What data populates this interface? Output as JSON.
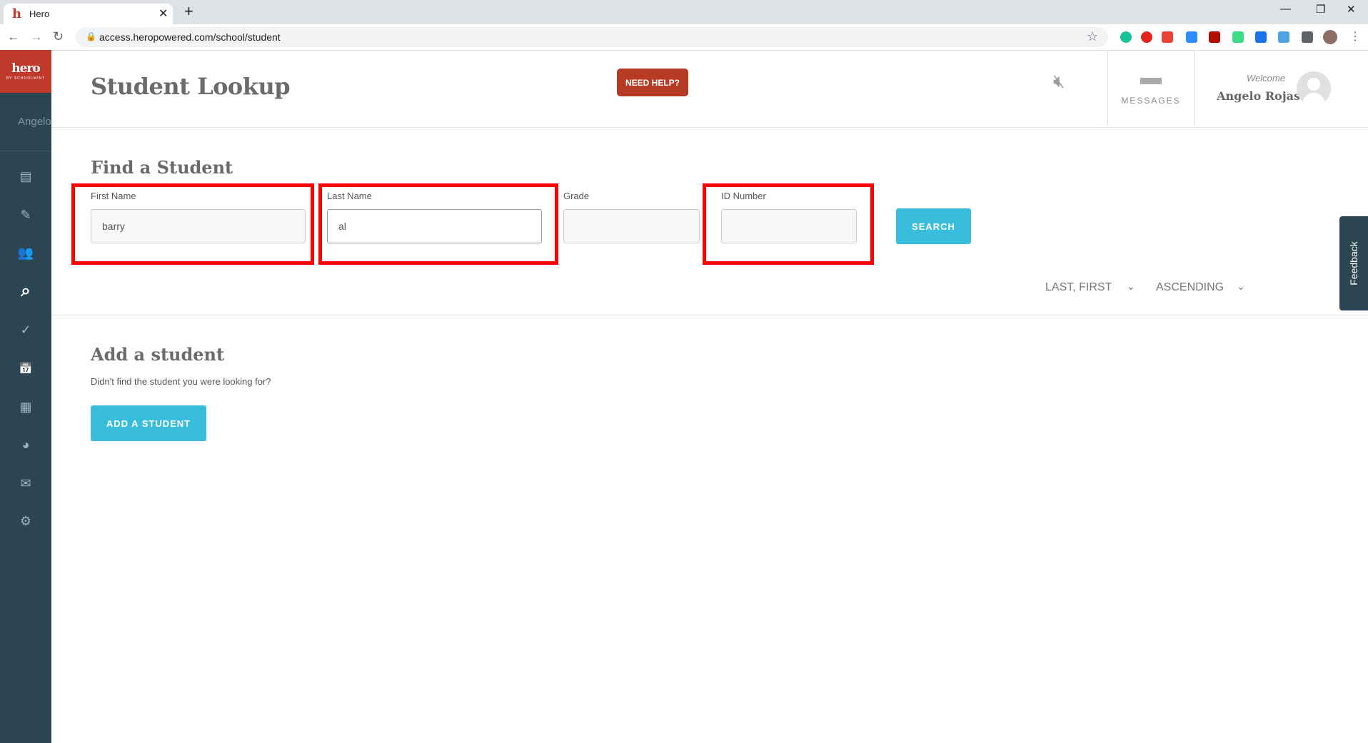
{
  "browser": {
    "tab_title": "Hero",
    "tab_favicon": "h",
    "new_tab_symbol": "+",
    "url": "access.heropowered.com/school/student"
  },
  "sidebar": {
    "logo": "hero",
    "logo_sub": "BY SCHOOLMINT",
    "user_name": "Angelo",
    "items": [
      {
        "icon": "dashboard-icon",
        "glyph": "▤"
      },
      {
        "icon": "pencil-icon",
        "glyph": "✎"
      },
      {
        "icon": "students-icon",
        "glyph": "👥"
      },
      {
        "icon": "search-icon",
        "glyph": "⌕"
      },
      {
        "icon": "check-icon",
        "glyph": "✓"
      },
      {
        "icon": "calendar-icon",
        "glyph": "📅"
      },
      {
        "icon": "document-icon",
        "glyph": "▦"
      },
      {
        "icon": "pie-chart-icon",
        "glyph": "◕"
      },
      {
        "icon": "mail-icon",
        "glyph": "✉"
      },
      {
        "icon": "gear-icon",
        "glyph": "⚙"
      }
    ]
  },
  "header": {
    "title": "Student Lookup",
    "help_button": "NEED HELP?",
    "messages_label": "MESSAGES",
    "welcome": "Welcome",
    "user_name": "Angelo Rojas"
  },
  "find": {
    "title": "Find a Student",
    "first_name_label": "First Name",
    "first_name_value": "barry",
    "last_name_label": "Last Name",
    "last_name_value": "al",
    "grade_label": "Grade",
    "grade_value": "",
    "id_label": "ID Number",
    "id_value": "",
    "search_button": "SEARCH",
    "sort_by": "LAST, FIRST",
    "sort_order": "ASCENDING"
  },
  "add": {
    "title": "Add a student",
    "subtitle": "Didn't find the student you were looking for?",
    "button": "ADD A STUDENT"
  },
  "feedback_label": "Feedback",
  "colors": {
    "brand_red": "#c0392b",
    "sidebar_bg": "#2b4652",
    "accent_blue": "#38bddc",
    "help_red": "#b73a25",
    "annotation_red": "#ff0000"
  }
}
